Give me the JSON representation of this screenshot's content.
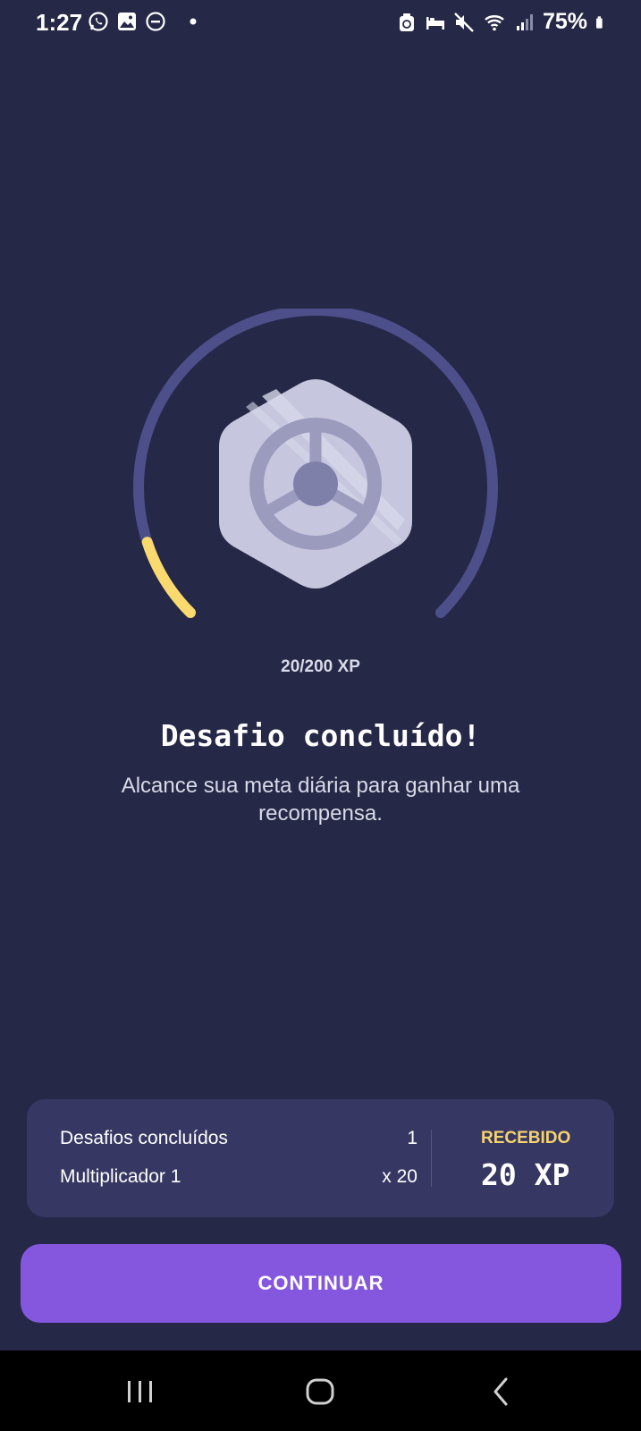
{
  "status_bar": {
    "time": "1:27",
    "battery": "75%",
    "left_icons": [
      "whatsapp-icon",
      "gallery-icon",
      "do-not-disturb-icon",
      "dot-icon"
    ],
    "right_icons": [
      "recycle-icon",
      "sleep-mode-icon",
      "mute-icon",
      "wifi-icon",
      "signal-icon",
      "battery-icon"
    ]
  },
  "progress": {
    "label": "20/200 XP",
    "current": 20,
    "total": 200,
    "track_color": "#4d4f8a",
    "fill_color": "#fad96e"
  },
  "badge": {
    "icon": "steering-wheel-icon"
  },
  "main": {
    "title": "Desafio concluído!",
    "subtitle": "Alcance sua meta diária para ganhar uma recompensa."
  },
  "summary": {
    "rows": [
      {
        "label": "Desafios concluídos",
        "value": "1"
      },
      {
        "label": "Multiplicador 1",
        "value": "x 20"
      }
    ],
    "received_label": "RECEBIDO",
    "received_value": "20 XP"
  },
  "actions": {
    "continue_label": "CONTINUAR"
  },
  "nav": {
    "recents_icon": "recents-icon",
    "home_icon": "home-icon",
    "back_icon": "back-icon"
  },
  "colors": {
    "background": "#252846",
    "card": "#363863",
    "accent": "#8557de",
    "highlight": "#f7d36b"
  }
}
